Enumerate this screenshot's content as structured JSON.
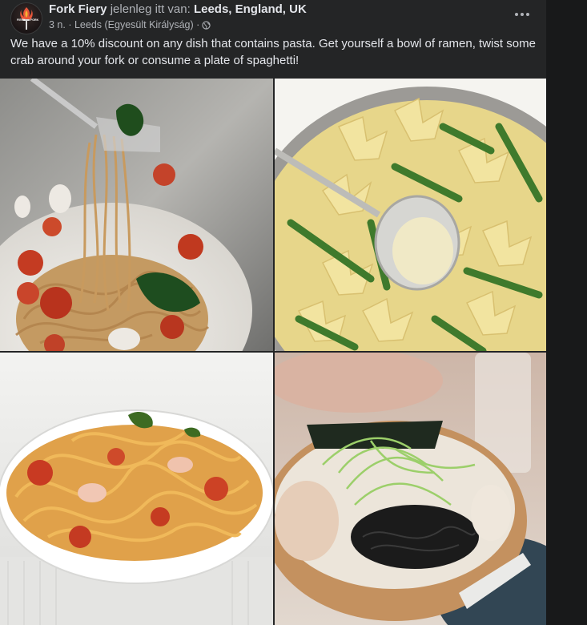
{
  "post": {
    "author": "Fork Fiery",
    "checkin_verb": "jelenleg itt van:",
    "location": "Leeds, England, UK",
    "meta": "3 n. · Leeds (Egyesült Királyság) ·",
    "audience_icon": "globe-icon",
    "more_icon": "more-dots-icon",
    "avatar_text": "FIERY FORK",
    "text": "We have a 10% discount on any dish that contains pasta. Get yourself a bowl of ramen, twist some crab around your fork or consume a plate of spaghetti!"
  },
  "photos": [
    {
      "subject": "spaghetti with spinach and cherry tomatoes on fork"
    },
    {
      "subject": "farfalle pasta with asparagus in pan"
    },
    {
      "subject": "linguine with crab and tomato sauce"
    },
    {
      "subject": "ramen bowl with green onions and seaweed"
    }
  ],
  "colors": {
    "background": "#18191a",
    "card": "#242526",
    "primary_text": "#e4e6eb",
    "secondary_text": "#b0b3b8"
  }
}
